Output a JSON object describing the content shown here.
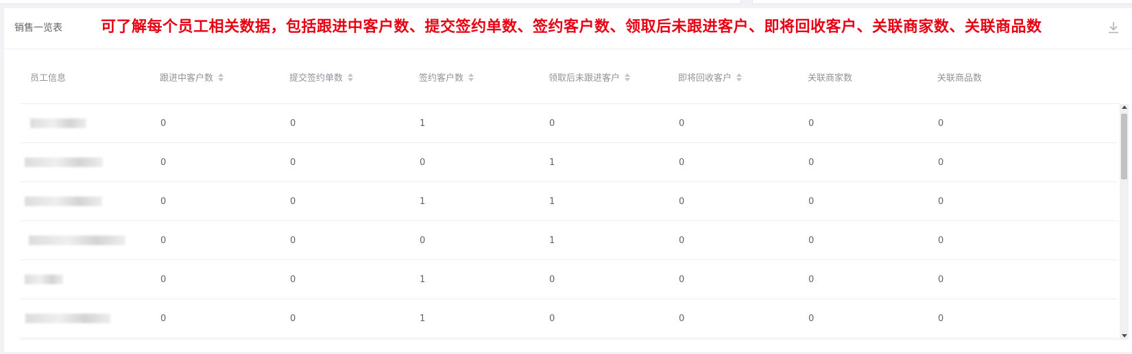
{
  "panel": {
    "title": "销售一览表",
    "annotation": "可了解每个员工相关数据，包括跟进中客户数、提交签约单数、签约客户数、领取后未跟进客户、即将回收客户、关联商家数、关联商品数",
    "icons": {
      "download": "download-icon",
      "sort": "sort-caret-icon"
    }
  },
  "table": {
    "columns": [
      {
        "label": "员工信息",
        "sortable": false
      },
      {
        "label": "跟进中客户数",
        "sortable": true
      },
      {
        "label": "提交签约单数",
        "sortable": true
      },
      {
        "label": "签约客户数",
        "sortable": true
      },
      {
        "label": "领取后未跟进客户",
        "sortable": true
      },
      {
        "label": "即将回收客户",
        "sortable": true
      },
      {
        "label": "关联商家数",
        "sortable": false
      },
      {
        "label": "关联商品数",
        "sortable": false
      }
    ],
    "rows": [
      {
        "employee": "",
        "values": [
          "0",
          "0",
          "1",
          "0",
          "0",
          "0",
          "0"
        ]
      },
      {
        "employee": "",
        "values": [
          "0",
          "0",
          "0",
          "1",
          "0",
          "0",
          "0"
        ]
      },
      {
        "employee": "",
        "values": [
          "0",
          "0",
          "1",
          "1",
          "0",
          "0",
          "0"
        ]
      },
      {
        "employee": "",
        "values": [
          "0",
          "0",
          "0",
          "1",
          "0",
          "0",
          "0"
        ]
      },
      {
        "employee": "",
        "values": [
          "0",
          "0",
          "1",
          "0",
          "0",
          "0",
          "0"
        ]
      },
      {
        "employee": "",
        "values": [
          "0",
          "0",
          "1",
          "0",
          "0",
          "0",
          "0"
        ]
      }
    ]
  },
  "colors": {
    "annotation": "#e60012",
    "header_text": "#909399",
    "cell_text": "#606266",
    "border": "#ebeef5"
  }
}
